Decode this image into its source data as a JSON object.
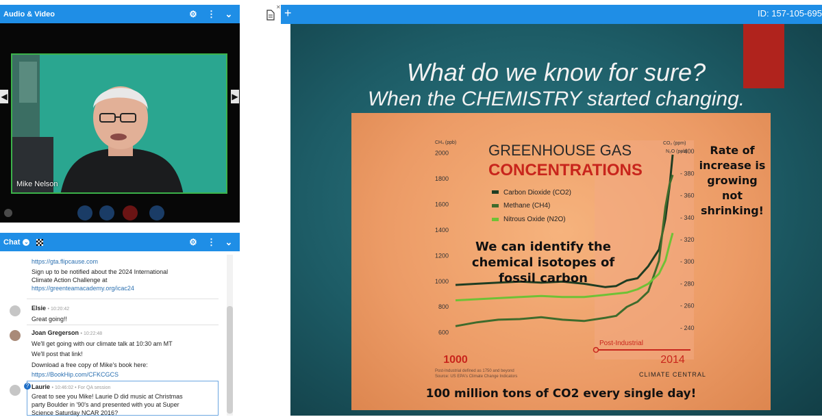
{
  "audio_video": {
    "title": "Audio & Video",
    "speaker_name": "Mike Nelson"
  },
  "chat": {
    "title": "Chat",
    "messages": [
      {
        "lines": [
          "https://gta.flipcause.com",
          "Sign up to be notified about the 2024 International",
          "Climate Action Challenge at",
          "https://greenteamacademy.org/icac24"
        ]
      },
      {
        "name": "Elsie",
        "time": "10:20:42",
        "text": "Great going!!"
      },
      {
        "name": "Joan Gregerson",
        "time": "10:22:48",
        "lines": [
          "We'll get going with our climate talk at 10:30 am MT",
          "We'll post that link!",
          "Download a free copy of Mike's book here:",
          "https://BookHip.com/CFKCGCS"
        ]
      },
      {
        "name": "Laurie",
        "time": "10:46:02",
        "tag": "For QA session",
        "lines": [
          "Great to see you Mike! Laurie D did music at Christmas",
          "party Boulder in '90's and presented with you at Super",
          "Science Saturday NCAR 2016?"
        ]
      }
    ]
  },
  "session": {
    "id_label": "ID: 157-105-695"
  },
  "slide": {
    "title_line1": "What do we know for sure?",
    "title_line2": "When the CHEMISTRY started changing.",
    "chart_heading_1": "GREENHOUSE GAS",
    "chart_heading_2": "CONCENTRATIONS",
    "rate_note": [
      "Rate of",
      "increase is",
      "growing",
      "not",
      "shrinking!"
    ],
    "isotopes_note": [
      "We can identify the",
      "chemical isotopes of",
      "fossil carbon"
    ],
    "post_industrial": "Post-Industrial",
    "footnote": [
      "Post-Industrial defined as 1750 and beyond",
      "Source: US EPA's Climate Change Indicators"
    ],
    "brand": "CLIMATE CENTRAL",
    "bottom_caption": "100 million tons of CO2 every single day!"
  },
  "chart_data": {
    "type": "line",
    "title": "GREENHOUSE GAS CONCENTRATIONS",
    "xlabel": "",
    "left_axis_label": "CH4 (ppb)",
    "right_axis_label": "CO2 (ppm) N2O (ppb)",
    "x_ticks": [
      "1000",
      "2014"
    ],
    "left_ticks": [
      "600",
      "800",
      "1000",
      "1200",
      "1400",
      "1600",
      "1800",
      "2000"
    ],
    "right_ticks": [
      "240",
      "260",
      "280",
      "300",
      "320",
      "340",
      "360",
      "380",
      "400"
    ],
    "left_ylim": [
      550,
      2100
    ],
    "right_ylim": [
      230,
      410
    ],
    "xlim": [
      1000,
      2014
    ],
    "series": [
      {
        "name": "Carbon Dioxide (CO2)",
        "color": "#1f3d22",
        "axis": "right",
        "x": [
          1000,
          1100,
          1200,
          1300,
          1400,
          1500,
          1600,
          1700,
          1750,
          1800,
          1850,
          1900,
          1950,
          1980,
          2000,
          2014
        ],
        "y": [
          279,
          280,
          281,
          282,
          281,
          282,
          280,
          277,
          278,
          283,
          285,
          296,
          311,
          339,
          369,
          397
        ]
      },
      {
        "name": "Methane (CH4)",
        "color": "#3f6b2c",
        "axis": "left",
        "x": [
          1000,
          1100,
          1200,
          1300,
          1400,
          1500,
          1600,
          1700,
          1750,
          1800,
          1850,
          1900,
          1950,
          1980,
          2000,
          2014
        ],
        "y": [
          650,
          680,
          700,
          705,
          720,
          700,
          690,
          715,
          730,
          800,
          840,
          920,
          1160,
          1580,
          1760,
          1830
        ]
      },
      {
        "name": "Nitrous Oxide (N2O)",
        "color": "#6fc136",
        "axis": "right",
        "x": [
          1000,
          1100,
          1200,
          1300,
          1400,
          1500,
          1600,
          1700,
          1750,
          1800,
          1850,
          1900,
          1950,
          1980,
          2000,
          2014
        ],
        "y": [
          265,
          266,
          267,
          268,
          269,
          268,
          268,
          270,
          271,
          272,
          275,
          280,
          289,
          301,
          316,
          326
        ]
      }
    ],
    "legend_position": "top-left",
    "grid": false
  },
  "colors": {
    "header_blue": "#1f8ee6",
    "video_border": "#3cb34a",
    "slide_bg": "#1d5c66",
    "chart_card": "#ec9b66",
    "heading_red": "#c8251c",
    "post_industrial_red": "#c8251c"
  }
}
